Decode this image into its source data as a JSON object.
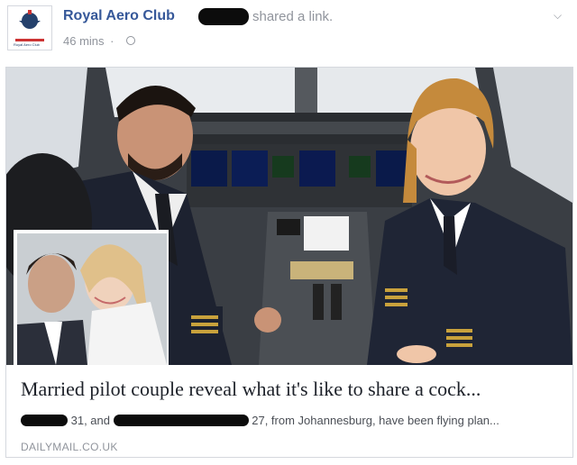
{
  "post": {
    "page_name": "Royal Aero Club",
    "action_text": "shared a link.",
    "time": "46 mins",
    "separator": "·",
    "avatar_text": "Royal Aero Club",
    "menu_icon": "chevron-down-icon",
    "privacy_icon": "globe-icon"
  },
  "link": {
    "headline": "Married pilot couple reveal what it's like to share a cock...",
    "desc_part1": "31, and",
    "desc_part2": "27, from Johannesburg, have been flying plan...",
    "domain": "DAILYMAIL.CO.UK"
  },
  "colors": {
    "link_blue": "#365899",
    "meta_gray": "#90949c",
    "text_dark": "#1d2129"
  }
}
